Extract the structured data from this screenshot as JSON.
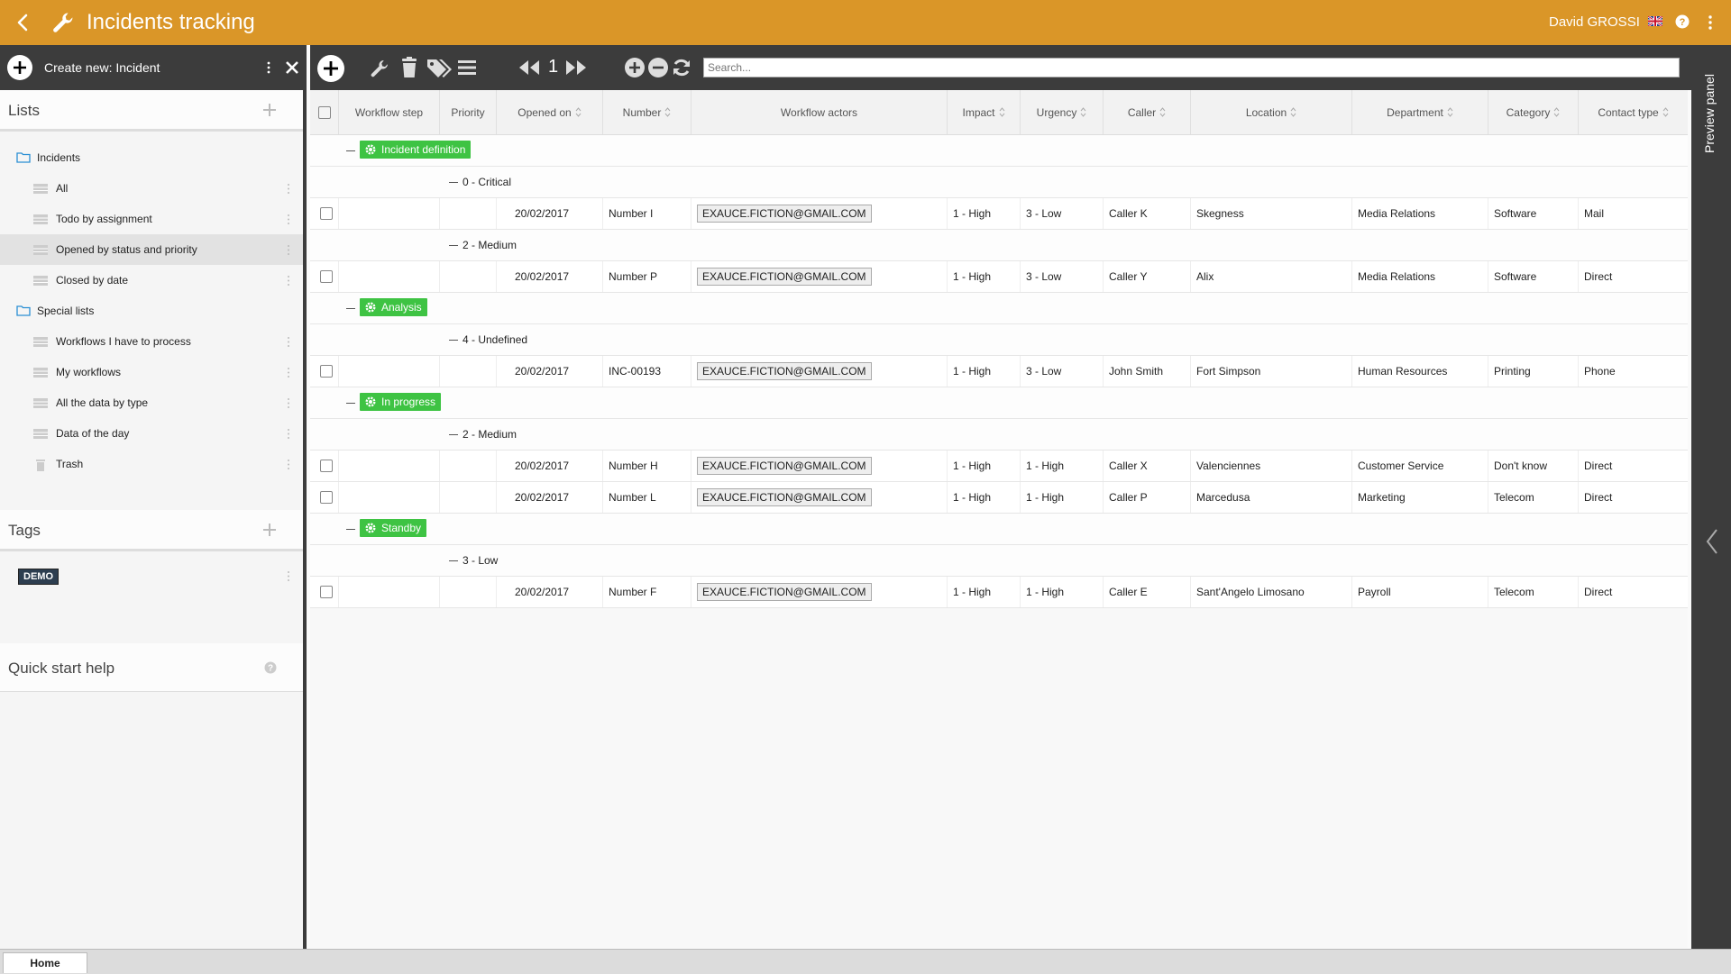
{
  "app": {
    "title": "Incidents tracking",
    "user": "David GROSSI",
    "accent_color": "#da9628",
    "icons": [
      "back-arrow-icon",
      "wrench-icon",
      "uk-flag-icon",
      "help-icon",
      "kebab-icon"
    ]
  },
  "left_panel": {
    "create_label": "Create new: Incident",
    "lists_title": "Lists",
    "tags_title": "Tags",
    "quick_help_title": "Quick start help",
    "folders": [
      {
        "label": "Incidents",
        "items": [
          {
            "label": "All",
            "active": false
          },
          {
            "label": "Todo by assignment",
            "active": false
          },
          {
            "label": "Opened by status and priority",
            "active": true
          },
          {
            "label": "Closed by date",
            "active": false
          }
        ]
      },
      {
        "label": "Special lists",
        "items": [
          {
            "label": "Workflows I have to process",
            "active": false
          },
          {
            "label": "My workflows",
            "active": false
          },
          {
            "label": "All the data by type",
            "active": false
          },
          {
            "label": "Data of the day",
            "active": false
          },
          {
            "label": "Trash",
            "active": false
          }
        ]
      }
    ],
    "tags": [
      "DEMO"
    ]
  },
  "toolbar": {
    "page": "1",
    "search_placeholder": "Search..."
  },
  "grid": {
    "columns": [
      "Workflow step",
      "Priority",
      "Opened on",
      "Number",
      "Workflow actors",
      "Impact",
      "Urgency",
      "Caller",
      "Location",
      "Department",
      "Category",
      "Contact type"
    ],
    "groups": [
      {
        "step": "Incident definition",
        "subgroups": [
          {
            "priority": "0 - Critical",
            "rows": [
              {
                "opened": "20/02/2017",
                "number": "Number I",
                "actor": "EXAUCE.FICTION@GMAIL.COM",
                "impact": "1 - High",
                "urgency": "3 - Low",
                "caller": "Caller K",
                "location": "Skegness",
                "department": "Media Relations",
                "category": "Software",
                "contact": "Mail"
              }
            ]
          },
          {
            "priority": "2 - Medium",
            "rows": [
              {
                "opened": "20/02/2017",
                "number": "Number P",
                "actor": "EXAUCE.FICTION@GMAIL.COM",
                "impact": "1 - High",
                "urgency": "3 - Low",
                "caller": "Caller Y",
                "location": "Alix",
                "department": "Media Relations",
                "category": "Software",
                "contact": "Direct"
              }
            ]
          }
        ]
      },
      {
        "step": "Analysis",
        "subgroups": [
          {
            "priority": "4 - Undefined",
            "rows": [
              {
                "opened": "20/02/2017",
                "number": "INC-00193",
                "actor": "EXAUCE.FICTION@GMAIL.COM",
                "impact": "1 - High",
                "urgency": "3 - Low",
                "caller": "John Smith",
                "location": "Fort Simpson",
                "department": "Human Resources",
                "category": "Printing",
                "contact": "Phone"
              }
            ]
          }
        ]
      },
      {
        "step": "In progress",
        "subgroups": [
          {
            "priority": "2 - Medium",
            "rows": [
              {
                "opened": "20/02/2017",
                "number": "Number H",
                "actor": "EXAUCE.FICTION@GMAIL.COM",
                "impact": "1 - High",
                "urgency": "1 - High",
                "caller": "Caller X",
                "location": "Valenciennes",
                "department": "Customer Service",
                "category": "Don't know",
                "contact": "Direct"
              },
              {
                "opened": "20/02/2017",
                "number": "Number L",
                "actor": "EXAUCE.FICTION@GMAIL.COM",
                "impact": "1 - High",
                "urgency": "1 - High",
                "caller": "Caller P",
                "location": "Marcedusa",
                "department": "Marketing",
                "category": "Telecom",
                "contact": "Direct"
              }
            ]
          }
        ]
      },
      {
        "step": "Standby",
        "subgroups": [
          {
            "priority": "3 - Low",
            "rows": [
              {
                "opened": "20/02/2017",
                "number": "Number F",
                "actor": "EXAUCE.FICTION@GMAIL.COM",
                "impact": "1 - High",
                "urgency": "1 - High",
                "caller": "Caller E",
                "location": "Sant'Angelo Limosano",
                "department": "Payroll",
                "category": "Telecom",
                "contact": "Direct"
              }
            ]
          }
        ]
      }
    ]
  },
  "preview_panel_label": "Preview panel",
  "bottom_tab": "Home",
  "colors": {
    "workflow_badge": "#3ec343",
    "panel_dark": "#3c3c3c",
    "tag_bg": "#2d3e50"
  }
}
